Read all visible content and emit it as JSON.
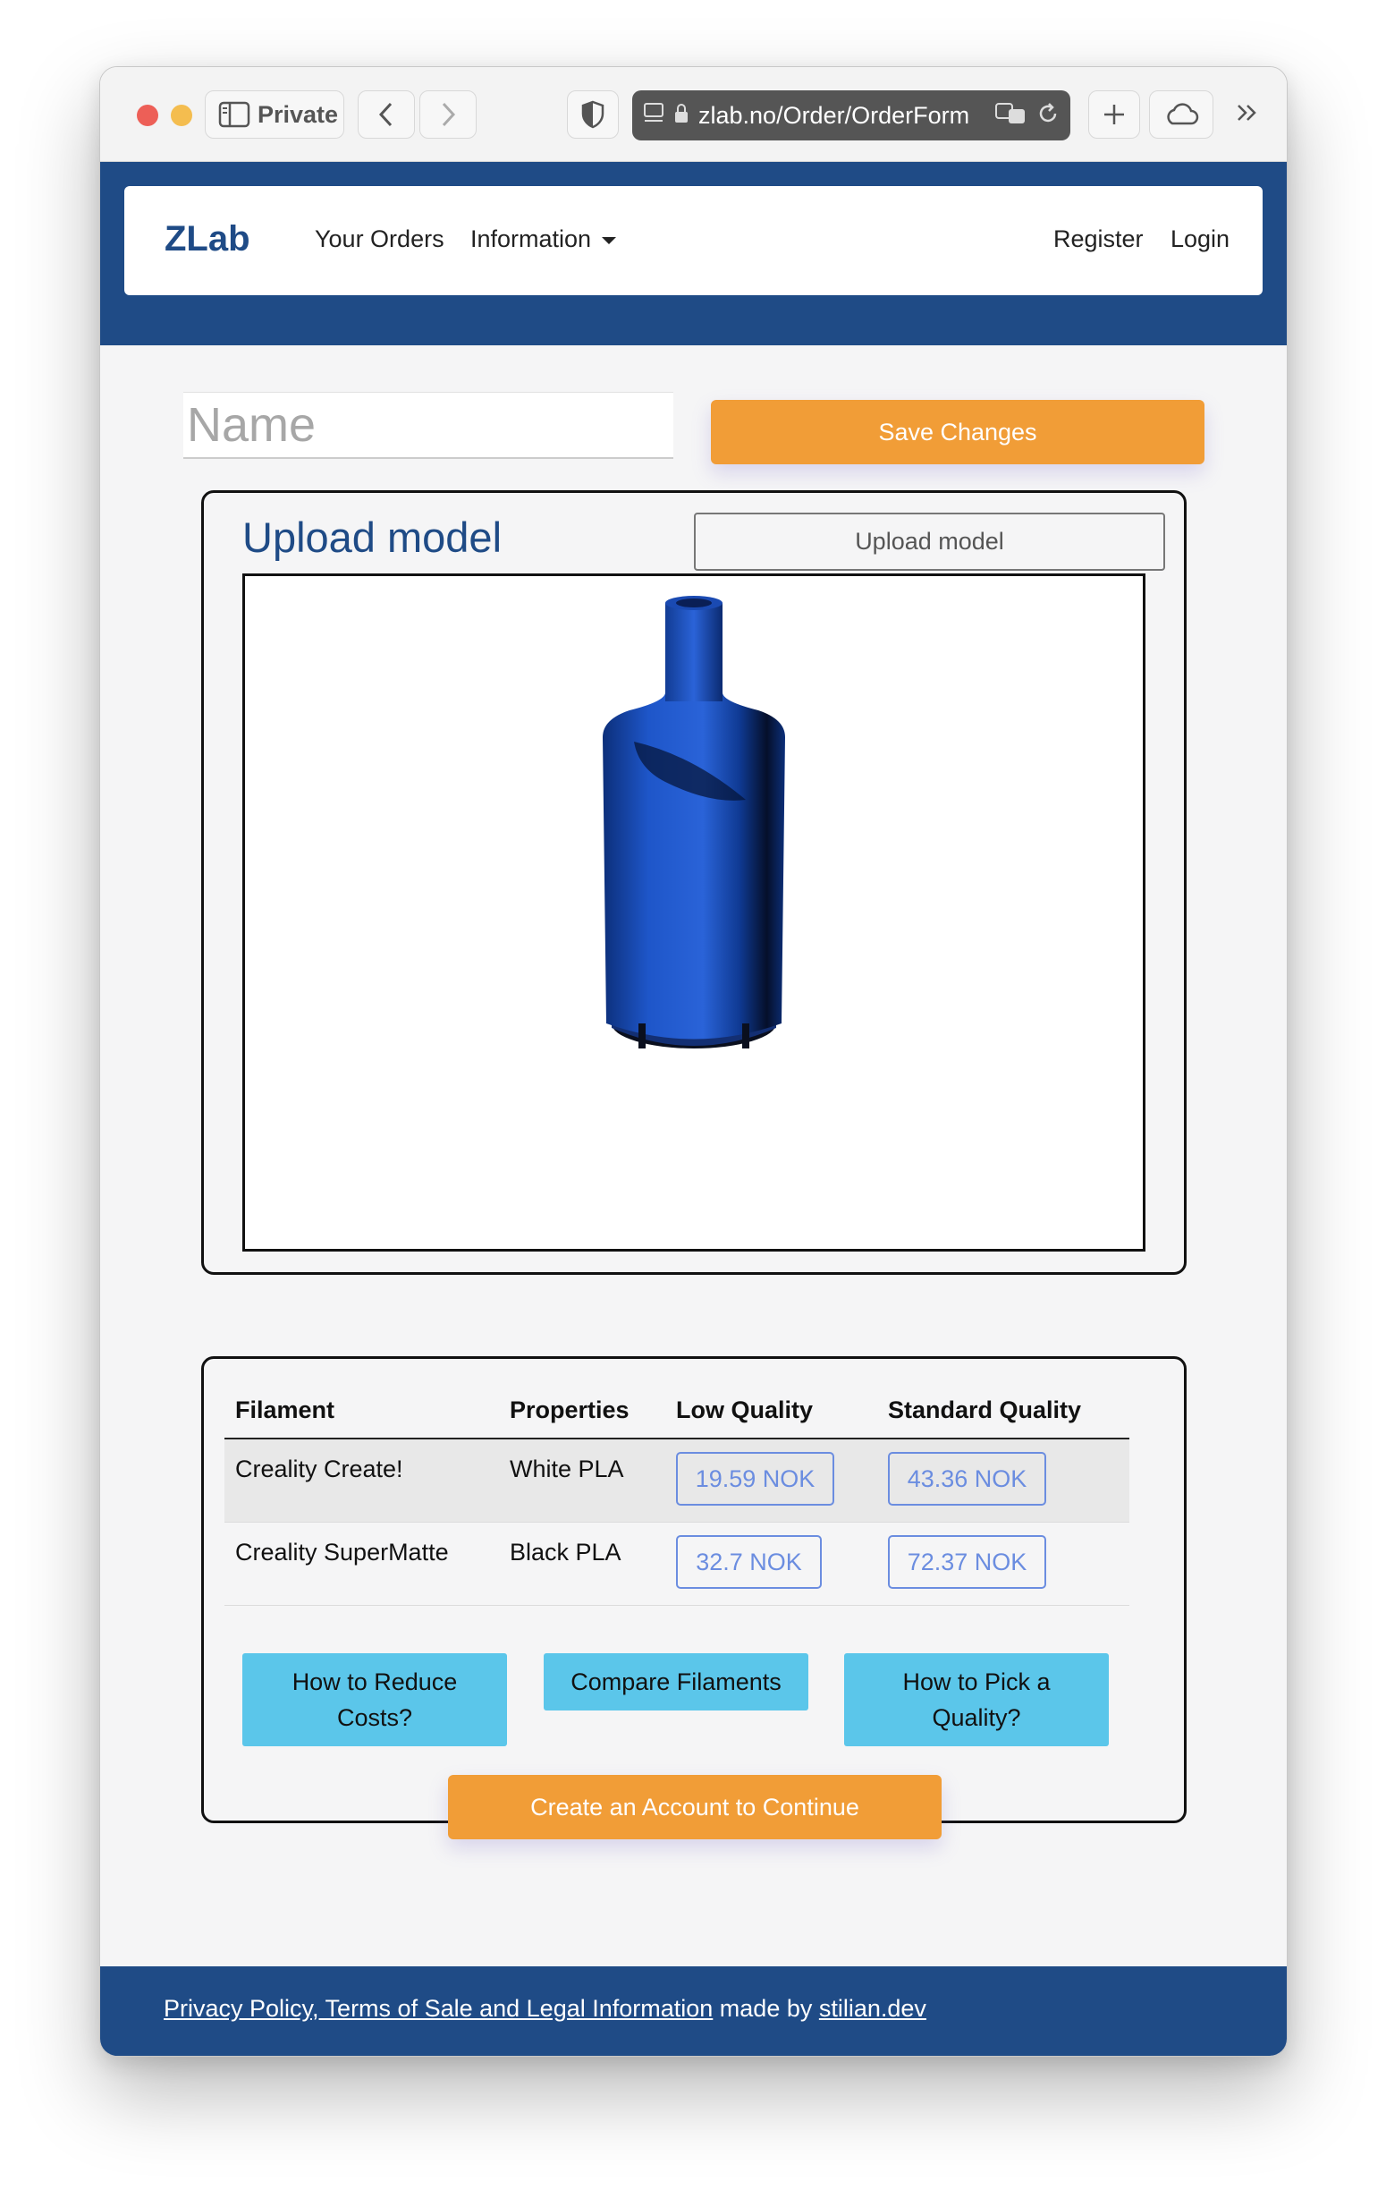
{
  "browser": {
    "private_label": "Private",
    "address": "zlab.no/Order/OrderForm"
  },
  "nav": {
    "brand": "ZLab",
    "your_orders": "Your Orders",
    "information": "Information",
    "register": "Register",
    "login": "Login"
  },
  "form": {
    "name_placeholder": "Name",
    "save_label": "Save Changes"
  },
  "upload": {
    "title": "Upload model",
    "button_label": "Upload model",
    "model_color": "#1e56c9"
  },
  "filaments": {
    "headers": [
      "Filament",
      "Properties",
      "Low Quality",
      "Standard Quality"
    ],
    "rows": [
      {
        "name": "Creality Create!",
        "properties": "White PLA",
        "low": "19.59 NOK",
        "standard": "43.36 NOK"
      },
      {
        "name": "Creality SuperMatte",
        "properties": "Black PLA",
        "low": "32.7 NOK",
        "standard": "72.37 NOK"
      }
    ]
  },
  "help": {
    "reduce_costs_line1": "How to Reduce",
    "reduce_costs_line2": "Costs?",
    "compare": "Compare Filaments",
    "pick_quality_line1": "How to Pick a",
    "pick_quality_line2": "Quality?"
  },
  "actions": {
    "create_account": "Create an Account to Continue"
  },
  "footer": {
    "legal_link": "Privacy Policy, Terms of Sale and Legal Information",
    "made_by": " made by ",
    "author_link": "stilian.dev"
  },
  "colors": {
    "brand_blue": "#1f4b86",
    "orange": "#f19d37",
    "light_blue": "#5bc6ea",
    "price_blue": "#6b8de0"
  }
}
